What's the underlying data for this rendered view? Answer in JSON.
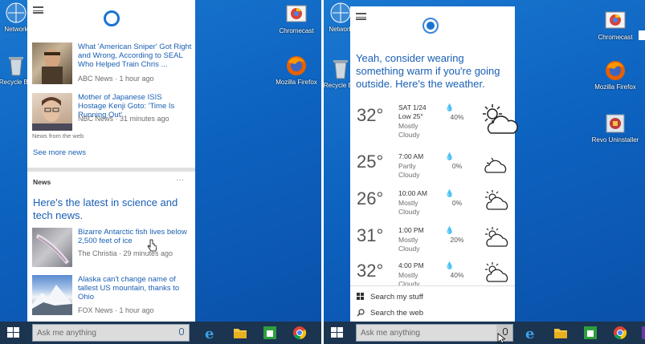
{
  "left": {
    "desktop_icons": [
      {
        "label": "Network",
        "icon": "network-icon"
      },
      {
        "label": "Recycle Bin",
        "icon": "recycle-bin-icon"
      },
      {
        "label": "Chromecast",
        "icon": "chromecast-icon"
      },
      {
        "label": "Mozilla Firefox",
        "icon": "firefox-icon"
      }
    ],
    "news_top": [
      {
        "title": "What 'American Sniper' Got Right and Wrong, According to SEAL Who Helped Train Chris ...",
        "source": "ABC News · 1 hour ago"
      },
      {
        "title": "Mother of Japanese ISIS Hostage Kenji Goto: 'Time Is Running Out'",
        "source": "NBC News · 31 minutes ago",
        "caption": "News from the web"
      }
    ],
    "see_more": "See more news",
    "section_label": "News",
    "section_more": "···",
    "headline": "Here's the latest in science and tech news.",
    "news_bottom": [
      {
        "title": "Bizarre Antarctic fish lives below 2,500 feet of ice",
        "source": "The Christia · 29 minutes ago"
      },
      {
        "title": "Alaska can't change name of tallest US mountain, thanks to Ohio",
        "source": "FOX News · 1 hour ago"
      }
    ],
    "search_placeholder": "Ask me anything"
  },
  "right": {
    "desktop_icons": [
      {
        "label": "Network",
        "icon": "network-icon"
      },
      {
        "label": "Recycle Bin",
        "icon": "recycle-bin-icon"
      },
      {
        "label": "Chromecast",
        "icon": "chromecast-icon"
      },
      {
        "label": "Mozilla Firefox",
        "icon": "firefox-icon"
      },
      {
        "label": "Revo Uninstaller",
        "icon": "revo-uninstaller-icon"
      }
    ],
    "message": "Yeah, consider wearing something warm if you're going outside. Here's the weather.",
    "weather_now": {
      "temp": "32°",
      "date": "SAT 1/24",
      "low": "Low 25°",
      "cond": "Mostly Cloudy",
      "precip": "40%"
    },
    "forecast": [
      {
        "temp": "25°",
        "time": "7:00 AM",
        "cond": "Partly Cloudy",
        "precip": "0%"
      },
      {
        "temp": "26°",
        "time": "10:00 AM",
        "cond": "Mostly Cloudy",
        "precip": "0%"
      },
      {
        "temp": "31°",
        "time": "1:00 PM",
        "cond": "Mostly Cloudy",
        "precip": "20%"
      },
      {
        "temp": "32°",
        "time": "4:00 PM",
        "cond": "Mostly Cloudy",
        "precip": "40%"
      }
    ],
    "search_my_stuff": "Search my stuff",
    "search_web": "Search the web",
    "search_placeholder": "Ask me anything"
  },
  "colors": {
    "accent": "#1a74d0",
    "link": "#1a5fb4",
    "taskbar": "#1b3450"
  }
}
